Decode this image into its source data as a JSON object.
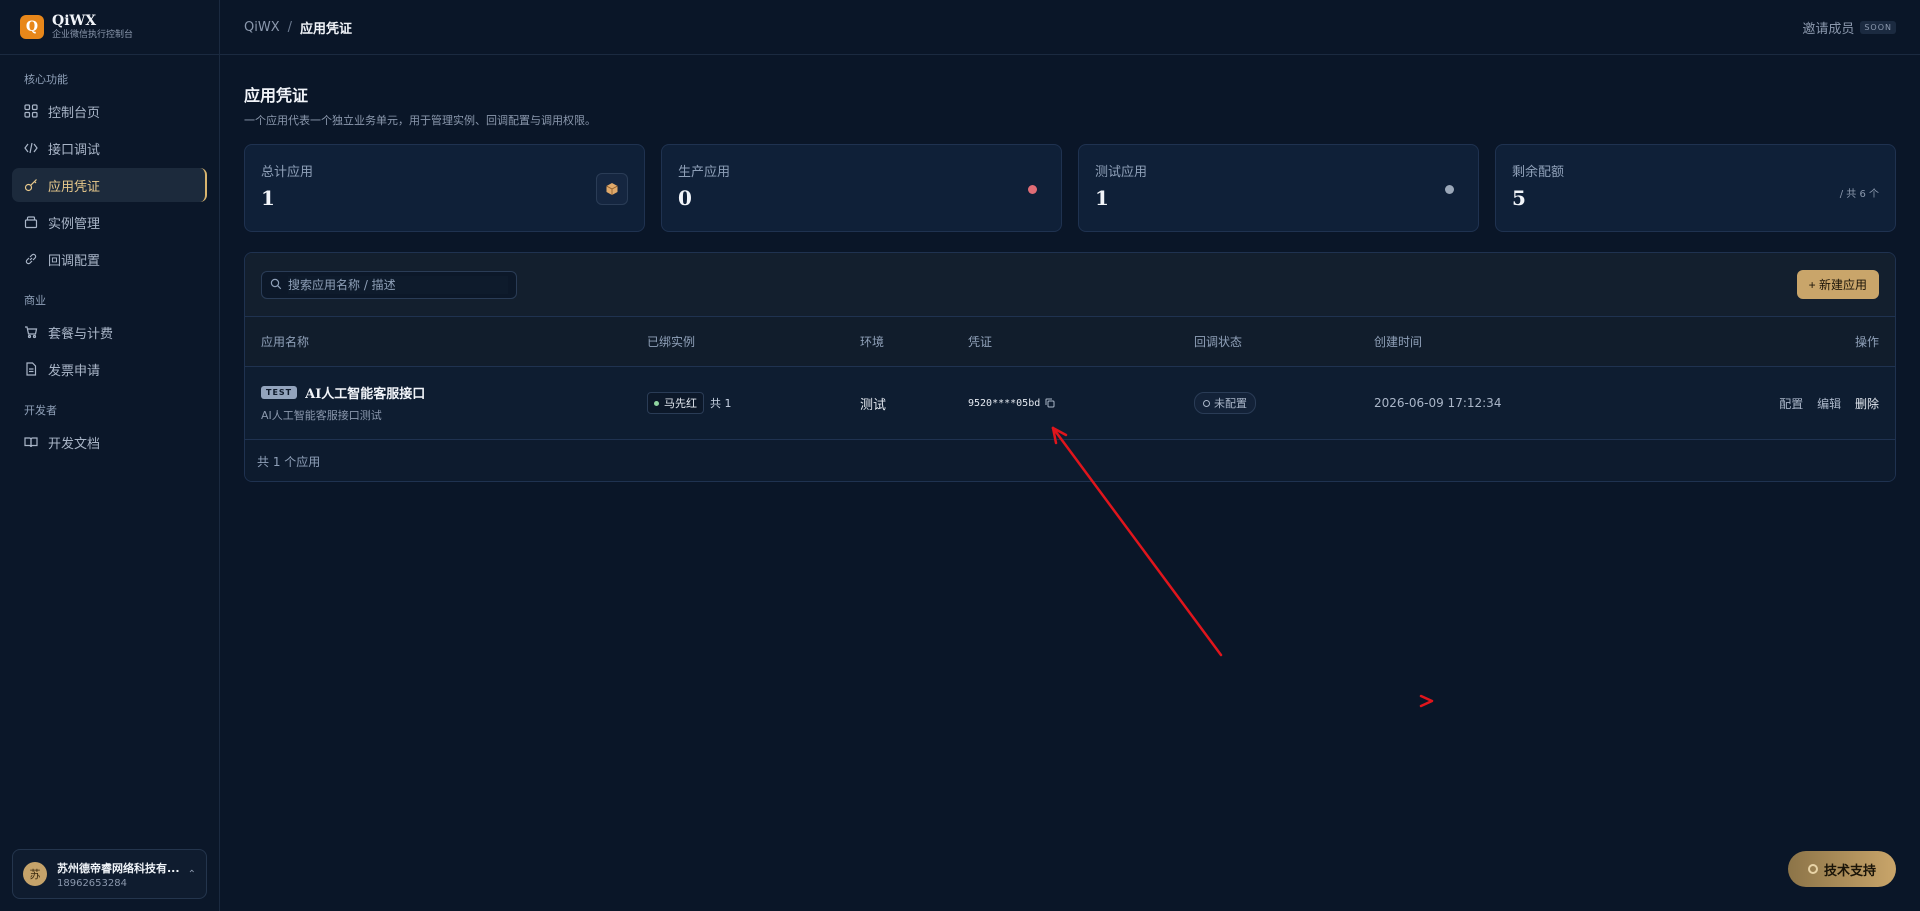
{
  "brand": {
    "logo_letter": "Q",
    "title": "QiWX",
    "subtitle": "企业微信执行控制台"
  },
  "sidebar": {
    "sections": [
      {
        "heading": "核心功能",
        "items": [
          {
            "label": "控制台页",
            "icon": "grid-icon"
          },
          {
            "label": "接口调试",
            "icon": "code-icon"
          },
          {
            "label": "应用凭证",
            "icon": "key-icon",
            "active": true
          },
          {
            "label": "实例管理",
            "icon": "box-icon"
          },
          {
            "label": "回调配置",
            "icon": "link-icon"
          }
        ]
      },
      {
        "heading": "商业",
        "items": [
          {
            "label": "套餐与计费",
            "icon": "cart-icon"
          },
          {
            "label": "发票申请",
            "icon": "document-icon"
          }
        ]
      },
      {
        "heading": "开发者",
        "items": [
          {
            "label": "开发文档",
            "icon": "book-icon"
          }
        ]
      }
    ],
    "user": {
      "avatar": "苏",
      "name": "苏州德帝睿网络科技有...",
      "phone": "18962653284"
    }
  },
  "topbar": {
    "crumb_root": "QiWX",
    "crumb_sep": "/",
    "crumb_current": "应用凭证",
    "invite_label": "邀请成员",
    "soon_badge": "SOON"
  },
  "page": {
    "title": "应用凭证",
    "description": "一个应用代表一个独立业务单元，用于管理实例、回调配置与调用权限。"
  },
  "stats": [
    {
      "label": "总计应用",
      "value": "1",
      "icon": "package-icon"
    },
    {
      "label": "生产应用",
      "value": "0",
      "dot_color": "#e06c75"
    },
    {
      "label": "测试应用",
      "value": "1",
      "dot_color": "#9aa7b8"
    },
    {
      "label": "剩余配额",
      "value": "5",
      "note": "/ 共 6 个"
    }
  ],
  "table": {
    "search_placeholder": "搜索应用名称 / 描述",
    "new_button": "+ 新建应用",
    "columns": [
      "应用名称",
      "已绑实例",
      "环境",
      "凭证",
      "回调状态",
      "创建时间",
      "操作"
    ],
    "rows": [
      {
        "tag": "TEST",
        "name": "AI人工智能客服接口",
        "description": "AI人工智能客服接口测试",
        "instance": "马先红",
        "instance_total": "共 1",
        "env": "测试",
        "credential": "9520****05bd",
        "callback": "未配置",
        "created": "2026-06-09 17:12:34",
        "actions": [
          "配置",
          "编辑",
          "删除"
        ]
      }
    ],
    "footer": "共 1 个应用"
  },
  "support_button": "技术支持",
  "colors": {
    "accent": "#c9a56a",
    "annotation": "#e0151c",
    "bg": "#0a1628"
  }
}
